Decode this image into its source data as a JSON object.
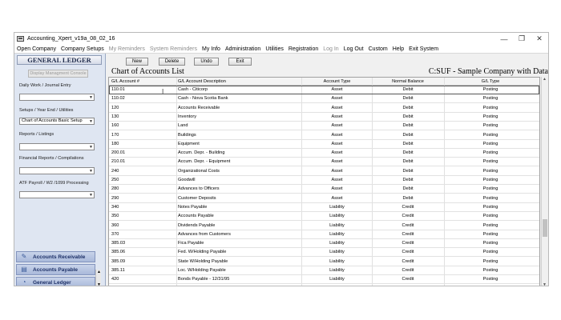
{
  "window": {
    "title": "Accounting_Xpert_v19a_08_02_16",
    "controls": [
      "—",
      "❐",
      "✕"
    ]
  },
  "menu": [
    {
      "label": "Open Company",
      "enabled": true
    },
    {
      "label": "Company Setups",
      "enabled": true
    },
    {
      "label": "My Reminders",
      "enabled": false
    },
    {
      "label": "System Reminders",
      "enabled": false
    },
    {
      "label": "My Info",
      "enabled": true
    },
    {
      "label": "Administration",
      "enabled": true
    },
    {
      "label": "Utilities",
      "enabled": true
    },
    {
      "label": "Registration",
      "enabled": true
    },
    {
      "label": "Log In",
      "enabled": false
    },
    {
      "label": "Log Out",
      "enabled": true
    },
    {
      "label": "Custom",
      "enabled": true
    },
    {
      "label": "Help",
      "enabled": true
    },
    {
      "label": "Exit System",
      "enabled": true
    }
  ],
  "sidebar": {
    "title": "GENERAL LEDGER",
    "display_button": "Display Managment Console",
    "groups": [
      {
        "label": "Daily Work / Journal Entry",
        "value": ""
      },
      {
        "label": "Setups / Year End / Utilities",
        "value": "Chart of Accounts Basic Setup"
      },
      {
        "label": "Reports / Listings",
        "value": ""
      },
      {
        "label": "Financial Reports / Compilations",
        "value": ""
      },
      {
        "label": "ATF Payroll / W2 /1099 Processing",
        "value": ""
      }
    ],
    "modules": [
      {
        "label": "Accounts Receivable",
        "icon": "ar-icon"
      },
      {
        "label": "Accounts Payable",
        "icon": "ap-icon"
      },
      {
        "label": "General Ledger",
        "icon": "gl-icon"
      }
    ]
  },
  "toolbar": {
    "new": "New",
    "delete": "Delete",
    "undo": "Undo",
    "exit": "Exit"
  },
  "list": {
    "title": "Chart of Accounts List",
    "company": "C:SUF - Sample Company with Data",
    "columns": [
      "G/L Account #",
      "G/L Account Description",
      "Account Type",
      "Normal Balance",
      "G/L Type"
    ],
    "rows": [
      [
        "110.01",
        "Cash - Citicorp",
        "Asset",
        "Debit",
        "Posting"
      ],
      [
        "110.02",
        "Cash - Nova Scotia Bank",
        "Asset",
        "Debit",
        "Posting"
      ],
      [
        "120",
        "Accounts Receivable",
        "Asset",
        "Debit",
        "Posting"
      ],
      [
        "130",
        "Inventory",
        "Asset",
        "Debit",
        "Posting"
      ],
      [
        "160",
        "Land",
        "Asset",
        "Debit",
        "Posting"
      ],
      [
        "170",
        "Buildings",
        "Asset",
        "Debit",
        "Posting"
      ],
      [
        "180",
        "Equipment",
        "Asset",
        "Debit",
        "Posting"
      ],
      [
        "200.01",
        "Accum. Depr. - Building",
        "Asset",
        "Debit",
        "Posting"
      ],
      [
        "210.01",
        "Accum. Depr. - Equipment",
        "Asset",
        "Debit",
        "Posting"
      ],
      [
        "240",
        "Organizational Costs",
        "Asset",
        "Debit",
        "Posting"
      ],
      [
        "250",
        "Goodwill",
        "Asset",
        "Debit",
        "Posting"
      ],
      [
        "280",
        "Advances to Officers",
        "Asset",
        "Debit",
        "Posting"
      ],
      [
        "290",
        "Customer Deposits",
        "Asset",
        "Debit",
        "Posting"
      ],
      [
        "340",
        "Notes Payable",
        "Liability",
        "Credit",
        "Posting"
      ],
      [
        "350",
        "Accounts Payable",
        "Liability",
        "Credit",
        "Posting"
      ],
      [
        "360",
        "Dividends Payable",
        "Liability",
        "Credit",
        "Posting"
      ],
      [
        "370",
        "Advances from Customers",
        "Liability",
        "Credit",
        "Posting"
      ],
      [
        "385.03",
        "Fica Payable",
        "Liability",
        "Credit",
        "Posting"
      ],
      [
        "385.06",
        "Fed. W/Holding Payable",
        "Liability",
        "Credit",
        "Posting"
      ],
      [
        "385.09",
        "State W/Holding Payable",
        "Liability",
        "Credit",
        "Posting"
      ],
      [
        "385.11",
        "Loc. W/Holding Payable",
        "Liability",
        "Credit",
        "Posting"
      ],
      [
        "420",
        "Bonds Payable - 12/31/95",
        "Liability",
        "Credit",
        "Posting"
      ]
    ]
  }
}
